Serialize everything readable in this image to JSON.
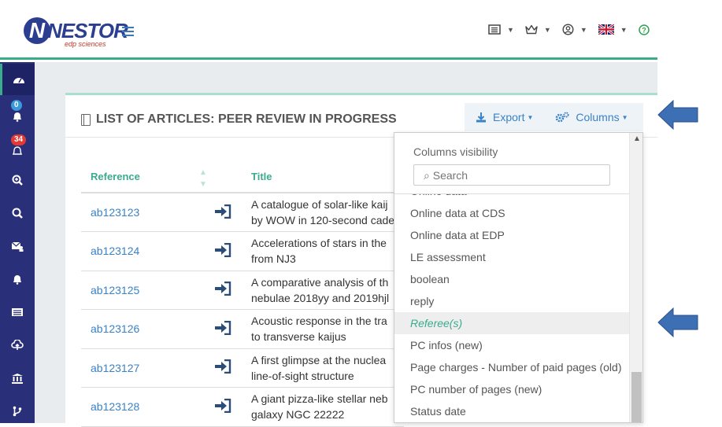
{
  "header": {
    "logo_text": "NESTOR",
    "logo_sub": "edp sciences"
  },
  "sidebar": {
    "badges": {
      "notifications_blue": "0",
      "notifications_red": "34"
    }
  },
  "card": {
    "title": "LIST OF ARTICLES: PEER REVIEW IN PROGRESS",
    "export_label": "Export",
    "columns_label": "Columns"
  },
  "table": {
    "headers": {
      "reference": "Reference",
      "title": "Title"
    },
    "rows": [
      {
        "ref": "ab123123",
        "title_l1": "A catalogue of solar-like kaij",
        "title_l2": "by WOW in 120-second cade"
      },
      {
        "ref": "ab123124",
        "title_l1": "Accelerations of stars in the",
        "title_l2": "from NJ3"
      },
      {
        "ref": "ab123125",
        "title_l1": "A comparative analysis of th",
        "title_l2": "nebulae 2018yy and 2019hjl"
      },
      {
        "ref": "ab123126",
        "title_l1": "Acoustic response in the tra",
        "title_l2": "to transverse kaijus"
      },
      {
        "ref": "ab123127",
        "title_l1": "A first glimpse at the nuclea",
        "title_l2": "line-of-sight structure"
      },
      {
        "ref": "ab123128",
        "title_l1": "A giant pizza-like stellar neb",
        "title_l2": "galaxy NGC 22222"
      }
    ]
  },
  "dropdown": {
    "title": "Columns visibility",
    "search_placeholder": "⌕ Search",
    "items": [
      "Online data",
      "Online data at CDS",
      "Online data at EDP",
      "LE assessment",
      "boolean",
      "reply",
      "Referee(s)",
      "PC infos (new)",
      "Page charges - Number of paid pages (old)",
      "PC number of pages (new)",
      "Status date"
    ]
  },
  "colors": {
    "accent": "#3aab8c",
    "sidebar": "#2a2f7a",
    "link": "#3a82c6",
    "arrow": "#3d6fb4"
  }
}
